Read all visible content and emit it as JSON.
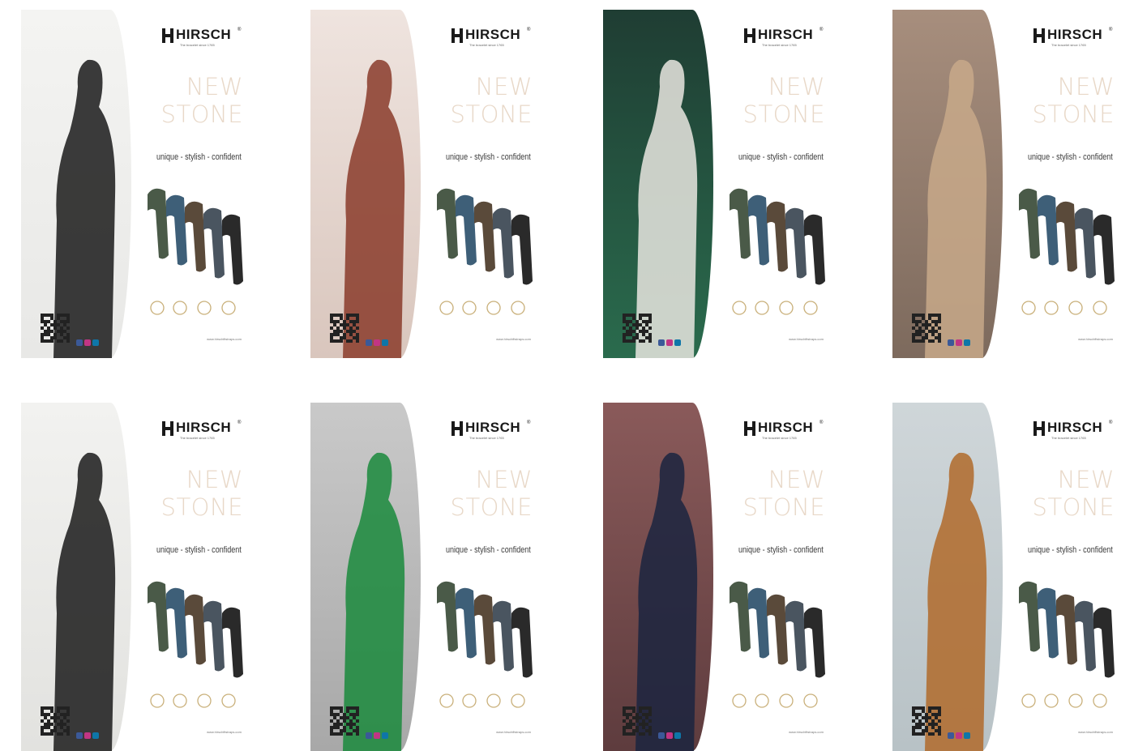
{
  "brand": {
    "name": "HIRSCH",
    "tagline": "The bracelet since 1765"
  },
  "headline": {
    "line1": "NEW",
    "line2": "STONE"
  },
  "slogan": "unique - stylish - confident",
  "url": "www.hirschfitstraps.com",
  "colors": {
    "headline": "#e8d8c8",
    "logo": "#1a1a1a",
    "strap_green": "#4a5a48",
    "strap_blue": "#3e5f78",
    "strap_brown": "#5a4a3a",
    "strap_slate": "#4a5560",
    "strap_black": "#2a2a2a",
    "badge_gold": "#c9b07a"
  },
  "banners": [
    {
      "scene": "man-white-shirt-watch",
      "photo_top": "#f4f4f2",
      "photo_bottom": "#e8e8e6",
      "accent": "#1a1a1a"
    },
    {
      "scene": "woman-scooter-street",
      "photo_top": "#efe4df",
      "photo_bottom": "#d9c6bd",
      "accent": "#8a3b2a"
    },
    {
      "scene": "man-green-vest",
      "photo_top": "#1f3d33",
      "photo_bottom": "#2a6b4d",
      "accent": "#e9e6e0"
    },
    {
      "scene": "woman-polka-dress",
      "photo_top": "#a78e7d",
      "photo_bottom": "#7d6a5d",
      "accent": "#c8a98a"
    },
    {
      "scene": "man-wrist-strap",
      "photo_top": "#f2f2f0",
      "photo_bottom": "#e2e2df",
      "accent": "#1a1a1a"
    },
    {
      "scene": "woman-flower-green-blouse",
      "photo_top": "#c9c9c9",
      "photo_bottom": "#a8a8a8",
      "accent": "#1a8a3c"
    },
    {
      "scene": "man-navy-suit",
      "photo_top": "#8a5a5a",
      "photo_bottom": "#5e3c3e",
      "accent": "#1b2540"
    },
    {
      "scene": "woman-orange-dress-sea",
      "photo_top": "#cfd6d9",
      "photo_bottom": "#b8c2c6",
      "accent": "#b06a2a"
    }
  ]
}
